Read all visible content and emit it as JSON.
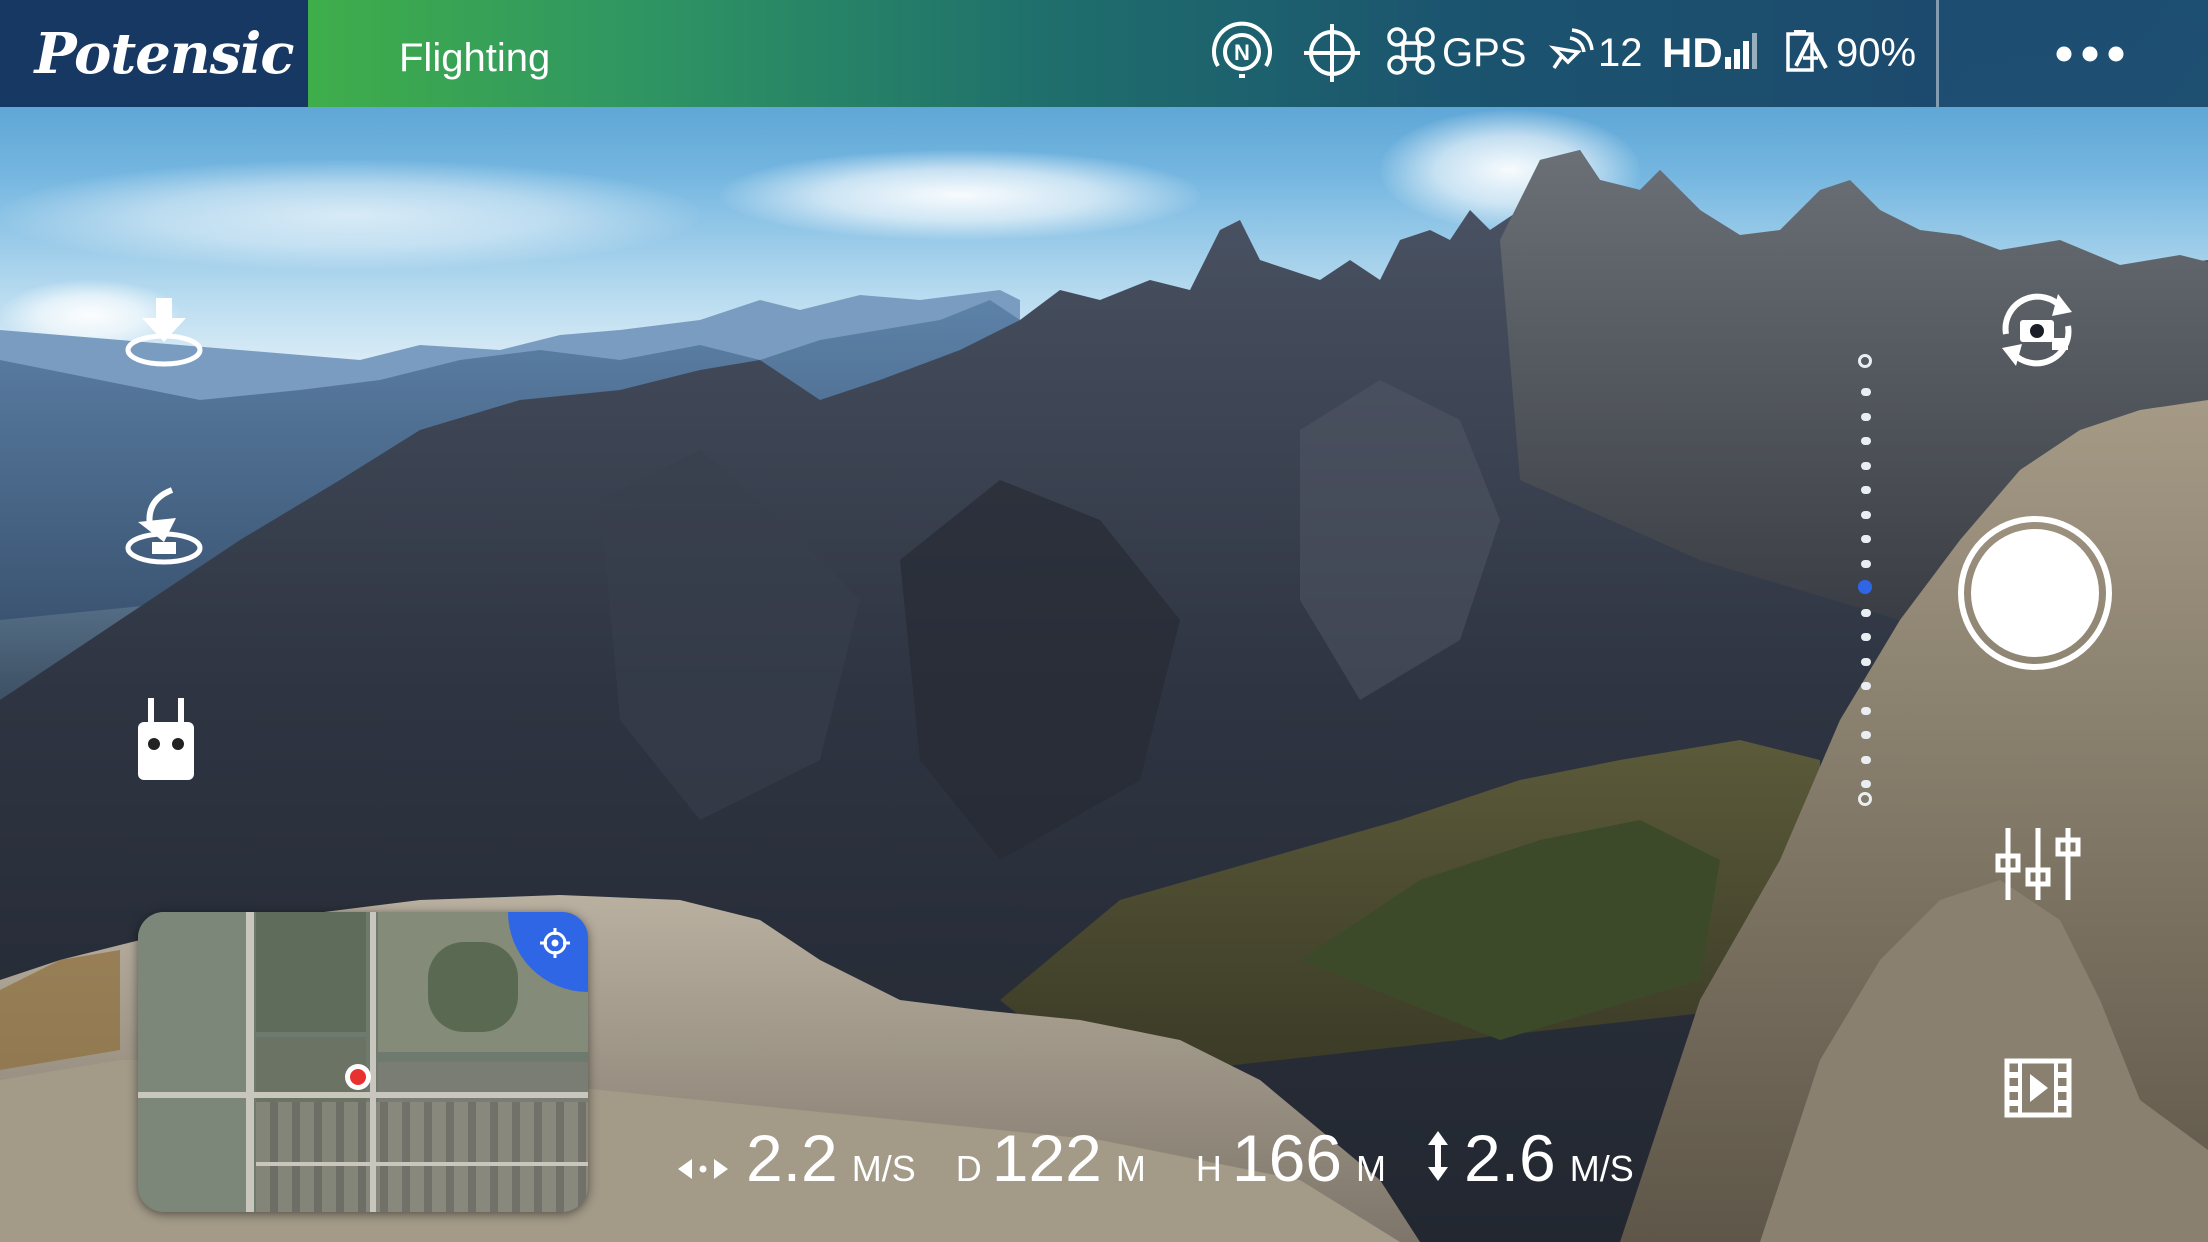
{
  "app": {
    "brand": "Potensic",
    "status_label": "Flighting"
  },
  "topbar": {
    "compass_letter": "N",
    "gps_label": "GPS",
    "satellites": "12",
    "hd_label": "HD",
    "battery": "90%"
  },
  "telemetry": {
    "horizontal_speed": "2.2",
    "horizontal_speed_unit": "M/S",
    "distance_label": "D",
    "distance": "122",
    "distance_unit": "M",
    "height_label": "H",
    "height": "166",
    "height_unit": "M",
    "vertical_speed": "2.6",
    "vertical_speed_unit": "M/S"
  },
  "zoom": {
    "ticks": 17,
    "active_index": 8
  },
  "colors": {
    "status_green": "#3fae4a",
    "topbar_blue": "#183864",
    "accent_blue": "#2f66e6",
    "home_point_red": "#e8322f"
  },
  "icons": {
    "left": [
      "takeoff-icon",
      "return-home-icon",
      "remote-controller-icon"
    ],
    "right": [
      "camera-switch-icon",
      "shutter-button",
      "settings-sliders-icon",
      "media-gallery-icon"
    ],
    "top": [
      "compass-icon",
      "crosshair-icon",
      "drone-icon",
      "satellite-icon",
      "signal-icon",
      "battery-icon",
      "more-icon"
    ]
  }
}
